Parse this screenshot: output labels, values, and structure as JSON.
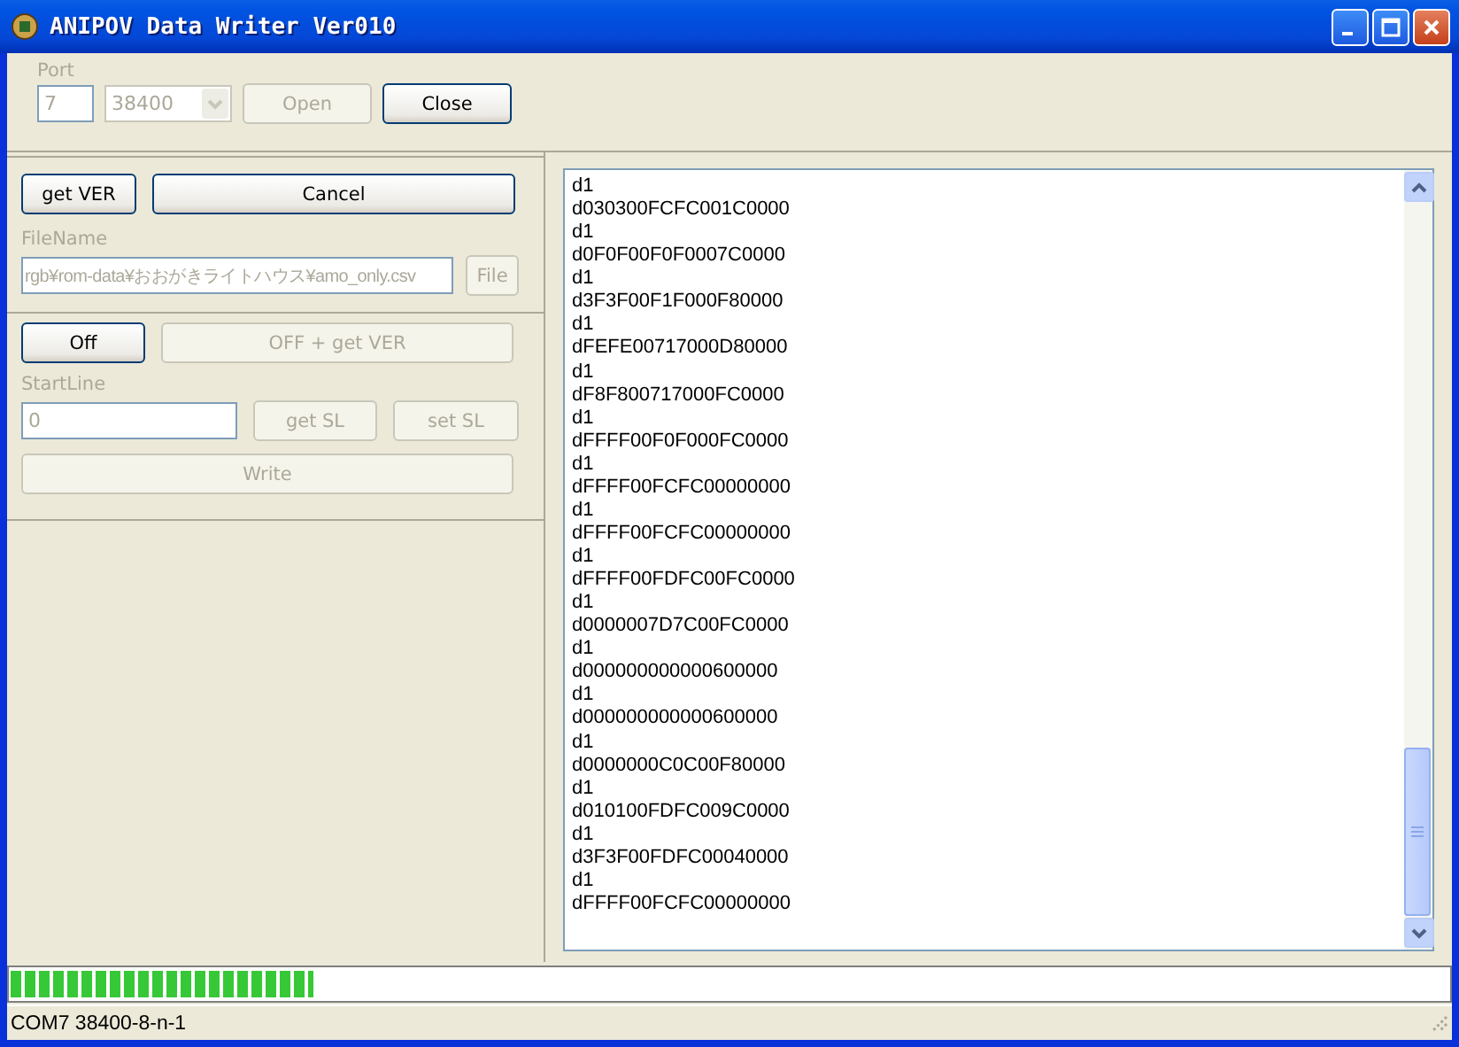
{
  "window": {
    "title": "ANIPOV Data Writer Ver010"
  },
  "port": {
    "label": "Port",
    "number": {
      "value": "7",
      "disabled": true
    },
    "baud": {
      "value": "38400",
      "disabled": true
    },
    "buttons": [
      {
        "label": "Open",
        "disabled": true
      },
      {
        "label": "Close",
        "disabled": false
      }
    ]
  },
  "file_section": {
    "buttons": [
      {
        "label": "get VER",
        "disabled": false
      },
      {
        "label": "Cancel",
        "disabled": false
      }
    ],
    "file_label": "FileName",
    "file_field": {
      "value": "rgb¥rom-data¥おおがきライトハウス¥amo_only.csv",
      "disabled": true
    },
    "file_button": {
      "label": "File",
      "disabled": true
    }
  },
  "write_section": {
    "buttons": [
      {
        "label": "Off",
        "disabled": false
      },
      {
        "label": "OFF + get VER",
        "disabled": true
      }
    ],
    "start_label": "StartLine",
    "start_field": {
      "value": "0",
      "disabled": true
    },
    "sl_buttons": [
      {
        "label": "get SL",
        "disabled": true
      },
      {
        "label": "set SL",
        "disabled": true
      }
    ],
    "write_button": {
      "label": "Write",
      "disabled": true
    }
  },
  "log": [
    "d1",
    "d030300FCFC001C0000",
    "d1",
    "d0F0F00F0F0007C0000",
    "d1",
    "d3F3F00F1F000F80000",
    "d1",
    "dFEFE00717000D80000",
    "d1",
    "dF8F800717000FC0000",
    "d1",
    "dFFFF00F0F000FC0000",
    "d1",
    "dFFFF00FCFC00000000",
    "d1",
    "dFFFF00FCFC00000000",
    "d1",
    "dFFFF00FDFC00FC0000",
    "d1",
    "d0000007D7C00FC0000",
    "d1",
    "d000000000000600000",
    "d1",
    "d000000000000600000",
    "d1",
    "d0000000C0C00F80000",
    "d1",
    "d010100FDFC009C0000",
    "d1",
    "d3F3F00FDFC00040000",
    "d1",
    "dFFFF00FCFC00000000"
  ],
  "progress": {
    "level": 0.21
  },
  "status_bar": "COM7 38400-8-n-1"
}
